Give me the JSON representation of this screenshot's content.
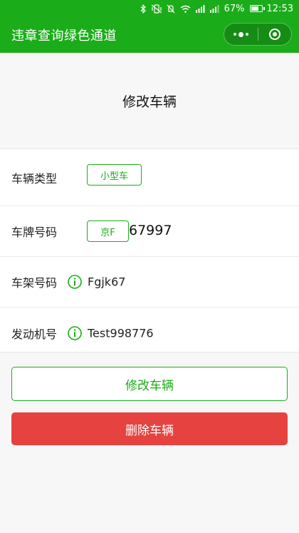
{
  "status_bar": {
    "battery": "67%",
    "time": "12:53",
    "icons": [
      "bluetooth-icon",
      "vibrate-icon",
      "mute-icon",
      "wifi-icon",
      "signal-icon",
      "signal-icon",
      "battery-icon"
    ]
  },
  "nav": {
    "title": "违章查询绿色通道",
    "background": "#1aad19",
    "menu_icon": "more-dots-icon",
    "close_icon": "close-target-icon"
  },
  "page": {
    "heading": "修改车辆"
  },
  "form": {
    "vehicle_type": {
      "label": "车辆类型",
      "value": "小型车"
    },
    "plate": {
      "label": "车牌号码",
      "prefix": "京F",
      "number": "67997"
    },
    "vin": {
      "label": "车架号码",
      "value": "Fgjk67",
      "icon": "info-icon"
    },
    "engine": {
      "label": "发动机号",
      "value": "Test998776",
      "icon": "info-icon"
    }
  },
  "actions": {
    "edit_label": "修改车辆",
    "delete_label": "删除车辆",
    "accent": "#1aad19",
    "danger": "#e64340"
  }
}
